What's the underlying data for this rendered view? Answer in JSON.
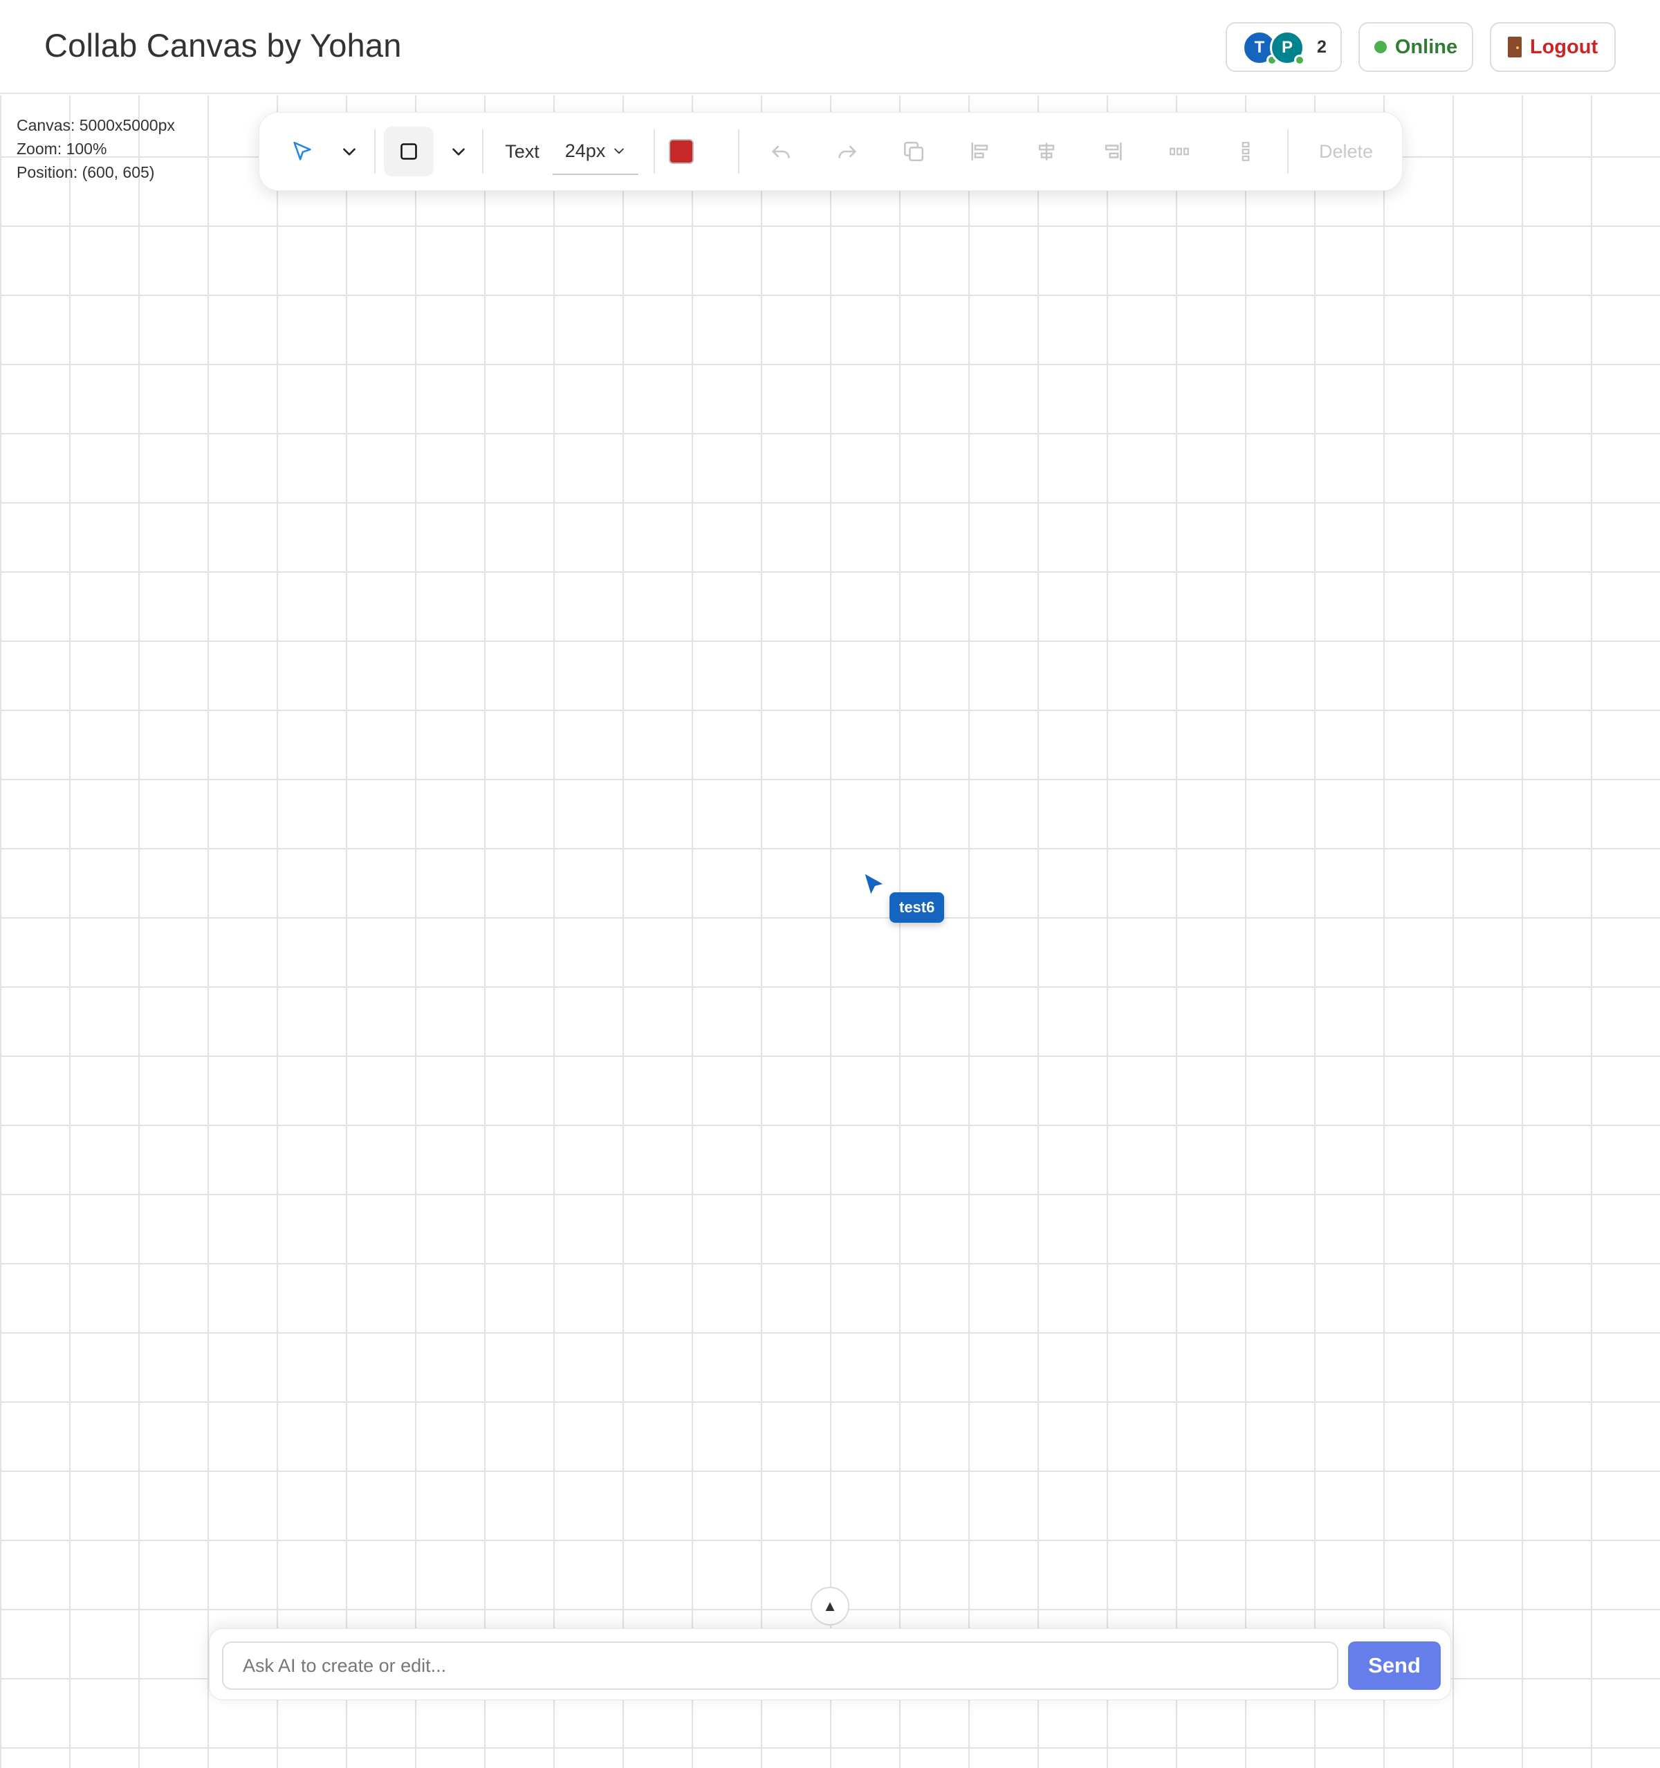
{
  "header": {
    "title": "Collab Canvas by Yohan",
    "presence": {
      "users": [
        {
          "initial": "T",
          "color": "#1565c0"
        },
        {
          "initial": "P",
          "color": "#00838f"
        }
      ],
      "count": "2",
      "status_dot_color": "#4caf50"
    },
    "status": {
      "label": "Online",
      "color": "#2e7d32",
      "dot_color": "#4caf50"
    },
    "logout": {
      "label": "Logout",
      "icon": "door-icon",
      "color": "#c62828"
    }
  },
  "canvas_info": {
    "size": "Canvas: 5000x5000px",
    "zoom": "Zoom: 100%",
    "position": "Position: (600, 605)"
  },
  "toolbar": {
    "select_tool": {
      "icon": "cursor-arrow-icon",
      "color": "#1e88e5"
    },
    "shape_tool": {
      "icon": "rectangle-icon",
      "active": true
    },
    "text_label": "Text",
    "font_size": "24px",
    "fill_color": "#c62828",
    "icons": [
      "undo-icon",
      "redo-icon",
      "duplicate-icon",
      "align-left-icon",
      "align-center-icon",
      "align-right-icon",
      "distribute-horizontal-icon",
      "distribute-vertical-icon"
    ],
    "delete_label": "Delete"
  },
  "remote_cursor": {
    "name": "test6",
    "color": "#1565c0"
  },
  "ai": {
    "toggle_icon": "▲",
    "placeholder": "Ask AI to create or edit...",
    "send_label": "Send",
    "send_color": "#667eea"
  }
}
